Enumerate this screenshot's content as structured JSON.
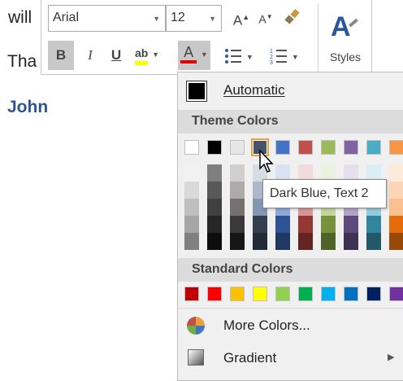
{
  "document": {
    "line1": "will",
    "line2": "Tha",
    "line3": "John"
  },
  "toolbar": {
    "font_name": "Arial",
    "font_size": "12",
    "bold_label": "B",
    "italic_label": "I",
    "underline_label": "U",
    "highlight_label": "ab",
    "font_color_label": "A",
    "grow_font_label": "A",
    "shrink_font_label": "A",
    "styles_label": "Styles",
    "highlight_color": "#ffff00",
    "font_color": "#e00000",
    "styles_icon_color": "#2b579a"
  },
  "color_menu": {
    "automatic_label": "Automatic",
    "theme_colors_heading": "Theme Colors",
    "standard_colors_heading": "Standard Colors",
    "more_colors_label": "More Colors...",
    "gradient_label": "Gradient",
    "theme_top_row": [
      "#ffffff",
      "#000000",
      "#e7e6e6",
      "#44546a",
      "#4472c4",
      "#c0504d",
      "#9bbb59",
      "#8064a2",
      "#4bacc6",
      "#f79646"
    ],
    "theme_shades": [
      [
        "#f2f2f2",
        "#d9d9d9",
        "#bfbfbf",
        "#a6a6a6",
        "#808080"
      ],
      [
        "#7f7f7f",
        "#595959",
        "#404040",
        "#262626",
        "#0d0d0d"
      ],
      [
        "#d0cece",
        "#aeaaaa",
        "#757171",
        "#3a3838",
        "#171616"
      ],
      [
        "#d6dce4",
        "#adb9ca",
        "#8497b0",
        "#333f4f",
        "#222a35"
      ],
      [
        "#d9e2f3",
        "#b4c6e7",
        "#8eaadb",
        "#2f5496",
        "#1f3864"
      ],
      [
        "#f2dcdb",
        "#e6b9b8",
        "#d99694",
        "#953735",
        "#632423"
      ],
      [
        "#ebf1de",
        "#d7e4bd",
        "#c3d69b",
        "#76923c",
        "#4f6228"
      ],
      [
        "#e5e0ec",
        "#ccc1da",
        "#b3a2c7",
        "#5f497a",
        "#3f3151"
      ],
      [
        "#dbeef4",
        "#b7dde8",
        "#93cddd",
        "#31859c",
        "#215968"
      ],
      [
        "#fdeada",
        "#fbd5b5",
        "#fac08f",
        "#e46c0a",
        "#984807"
      ]
    ],
    "standard_colors": [
      "#c00000",
      "#ff0000",
      "#ffc000",
      "#ffff00",
      "#92d050",
      "#00b050",
      "#00b0f0",
      "#0070c0",
      "#002060",
      "#7030a0"
    ],
    "hovered_color_name": "Dark Blue, Text 2"
  }
}
